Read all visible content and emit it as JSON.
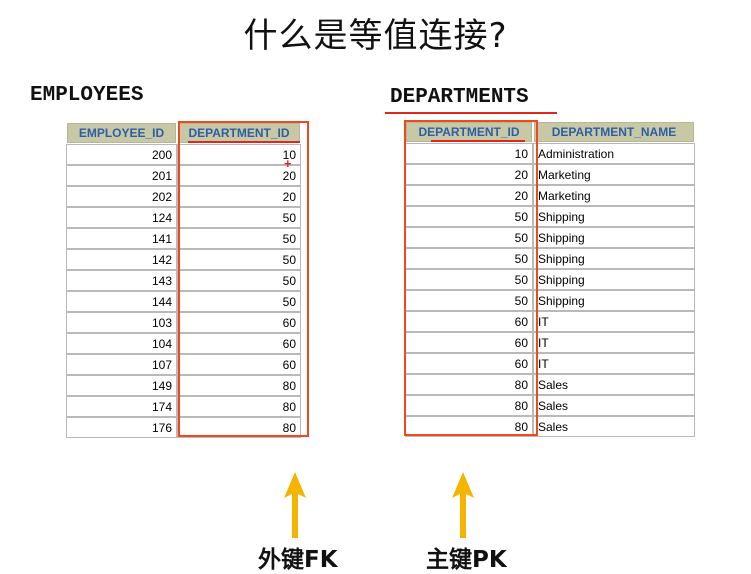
{
  "title": "什么是等值连接?",
  "employees": {
    "name": "EMPLOYEES",
    "headers": [
      "EMPLOYEE_ID",
      "DEPARTMENT_ID"
    ],
    "rows": [
      [
        "200",
        "10"
      ],
      [
        "201",
        "20"
      ],
      [
        "202",
        "20"
      ],
      [
        "124",
        "50"
      ],
      [
        "141",
        "50"
      ],
      [
        "142",
        "50"
      ],
      [
        "143",
        "50"
      ],
      [
        "144",
        "50"
      ],
      [
        "103",
        "60"
      ],
      [
        "104",
        "60"
      ],
      [
        "107",
        "60"
      ],
      [
        "149",
        "80"
      ],
      [
        "174",
        "80"
      ],
      [
        "176",
        "80"
      ]
    ]
  },
  "departments": {
    "name": "DEPARTMENTS",
    "headers": [
      "DEPARTMENT_ID",
      "DEPARTMENT_NAME"
    ],
    "rows": [
      [
        "10",
        "Administration"
      ],
      [
        "20",
        "Marketing"
      ],
      [
        "20",
        "Marketing"
      ],
      [
        "50",
        "Shipping"
      ],
      [
        "50",
        "Shipping"
      ],
      [
        "50",
        "Shipping"
      ],
      [
        "50",
        "Shipping"
      ],
      [
        "50",
        "Shipping"
      ],
      [
        "60",
        "IT"
      ],
      [
        "60",
        "IT"
      ],
      [
        "60",
        "IT"
      ],
      [
        "80",
        "Sales"
      ],
      [
        "80",
        "Sales"
      ],
      [
        "80",
        "Sales"
      ]
    ]
  },
  "labels": {
    "fk": "外键FK",
    "pk": "主键PK"
  },
  "colors": {
    "highlight": "#ef4a1e",
    "arrow": "#f5b400",
    "header_bg": "#c8c8a6",
    "header_text": "#2b5fa5"
  }
}
